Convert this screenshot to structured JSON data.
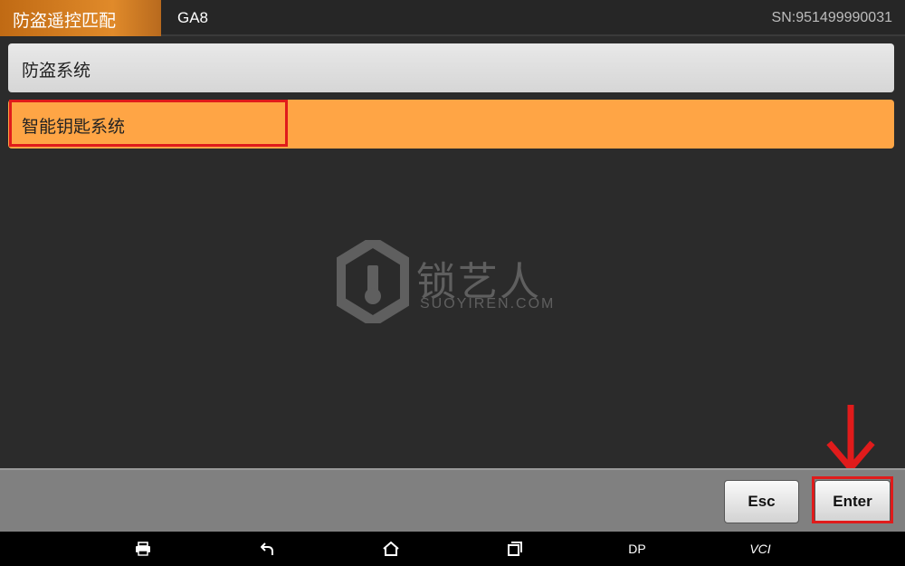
{
  "header": {
    "title": "防盗遥控匹配",
    "model": "GA8",
    "serial": "SN:951499990031"
  },
  "menu": {
    "items": [
      {
        "label": "防盗系统",
        "selected": false
      },
      {
        "label": "智能钥匙系统",
        "selected": true
      }
    ]
  },
  "watermark": {
    "brand_cn": "锁艺人",
    "brand_en": "SUOYIREN.COM",
    "icon": "suoyiren-logo-icon"
  },
  "actions": {
    "esc_label": "Esc",
    "enter_label": "Enter"
  },
  "system_bar": {
    "items": [
      {
        "icon": "print-icon"
      },
      {
        "icon": "back-icon"
      },
      {
        "icon": "home-icon"
      },
      {
        "icon": "recent-apps-icon"
      },
      {
        "label": "DP"
      },
      {
        "label": "VCI"
      }
    ]
  },
  "colors": {
    "accent_orange": "#ffa545",
    "annotation_red": "#e01b1b",
    "background": "#2b2b2b"
  }
}
